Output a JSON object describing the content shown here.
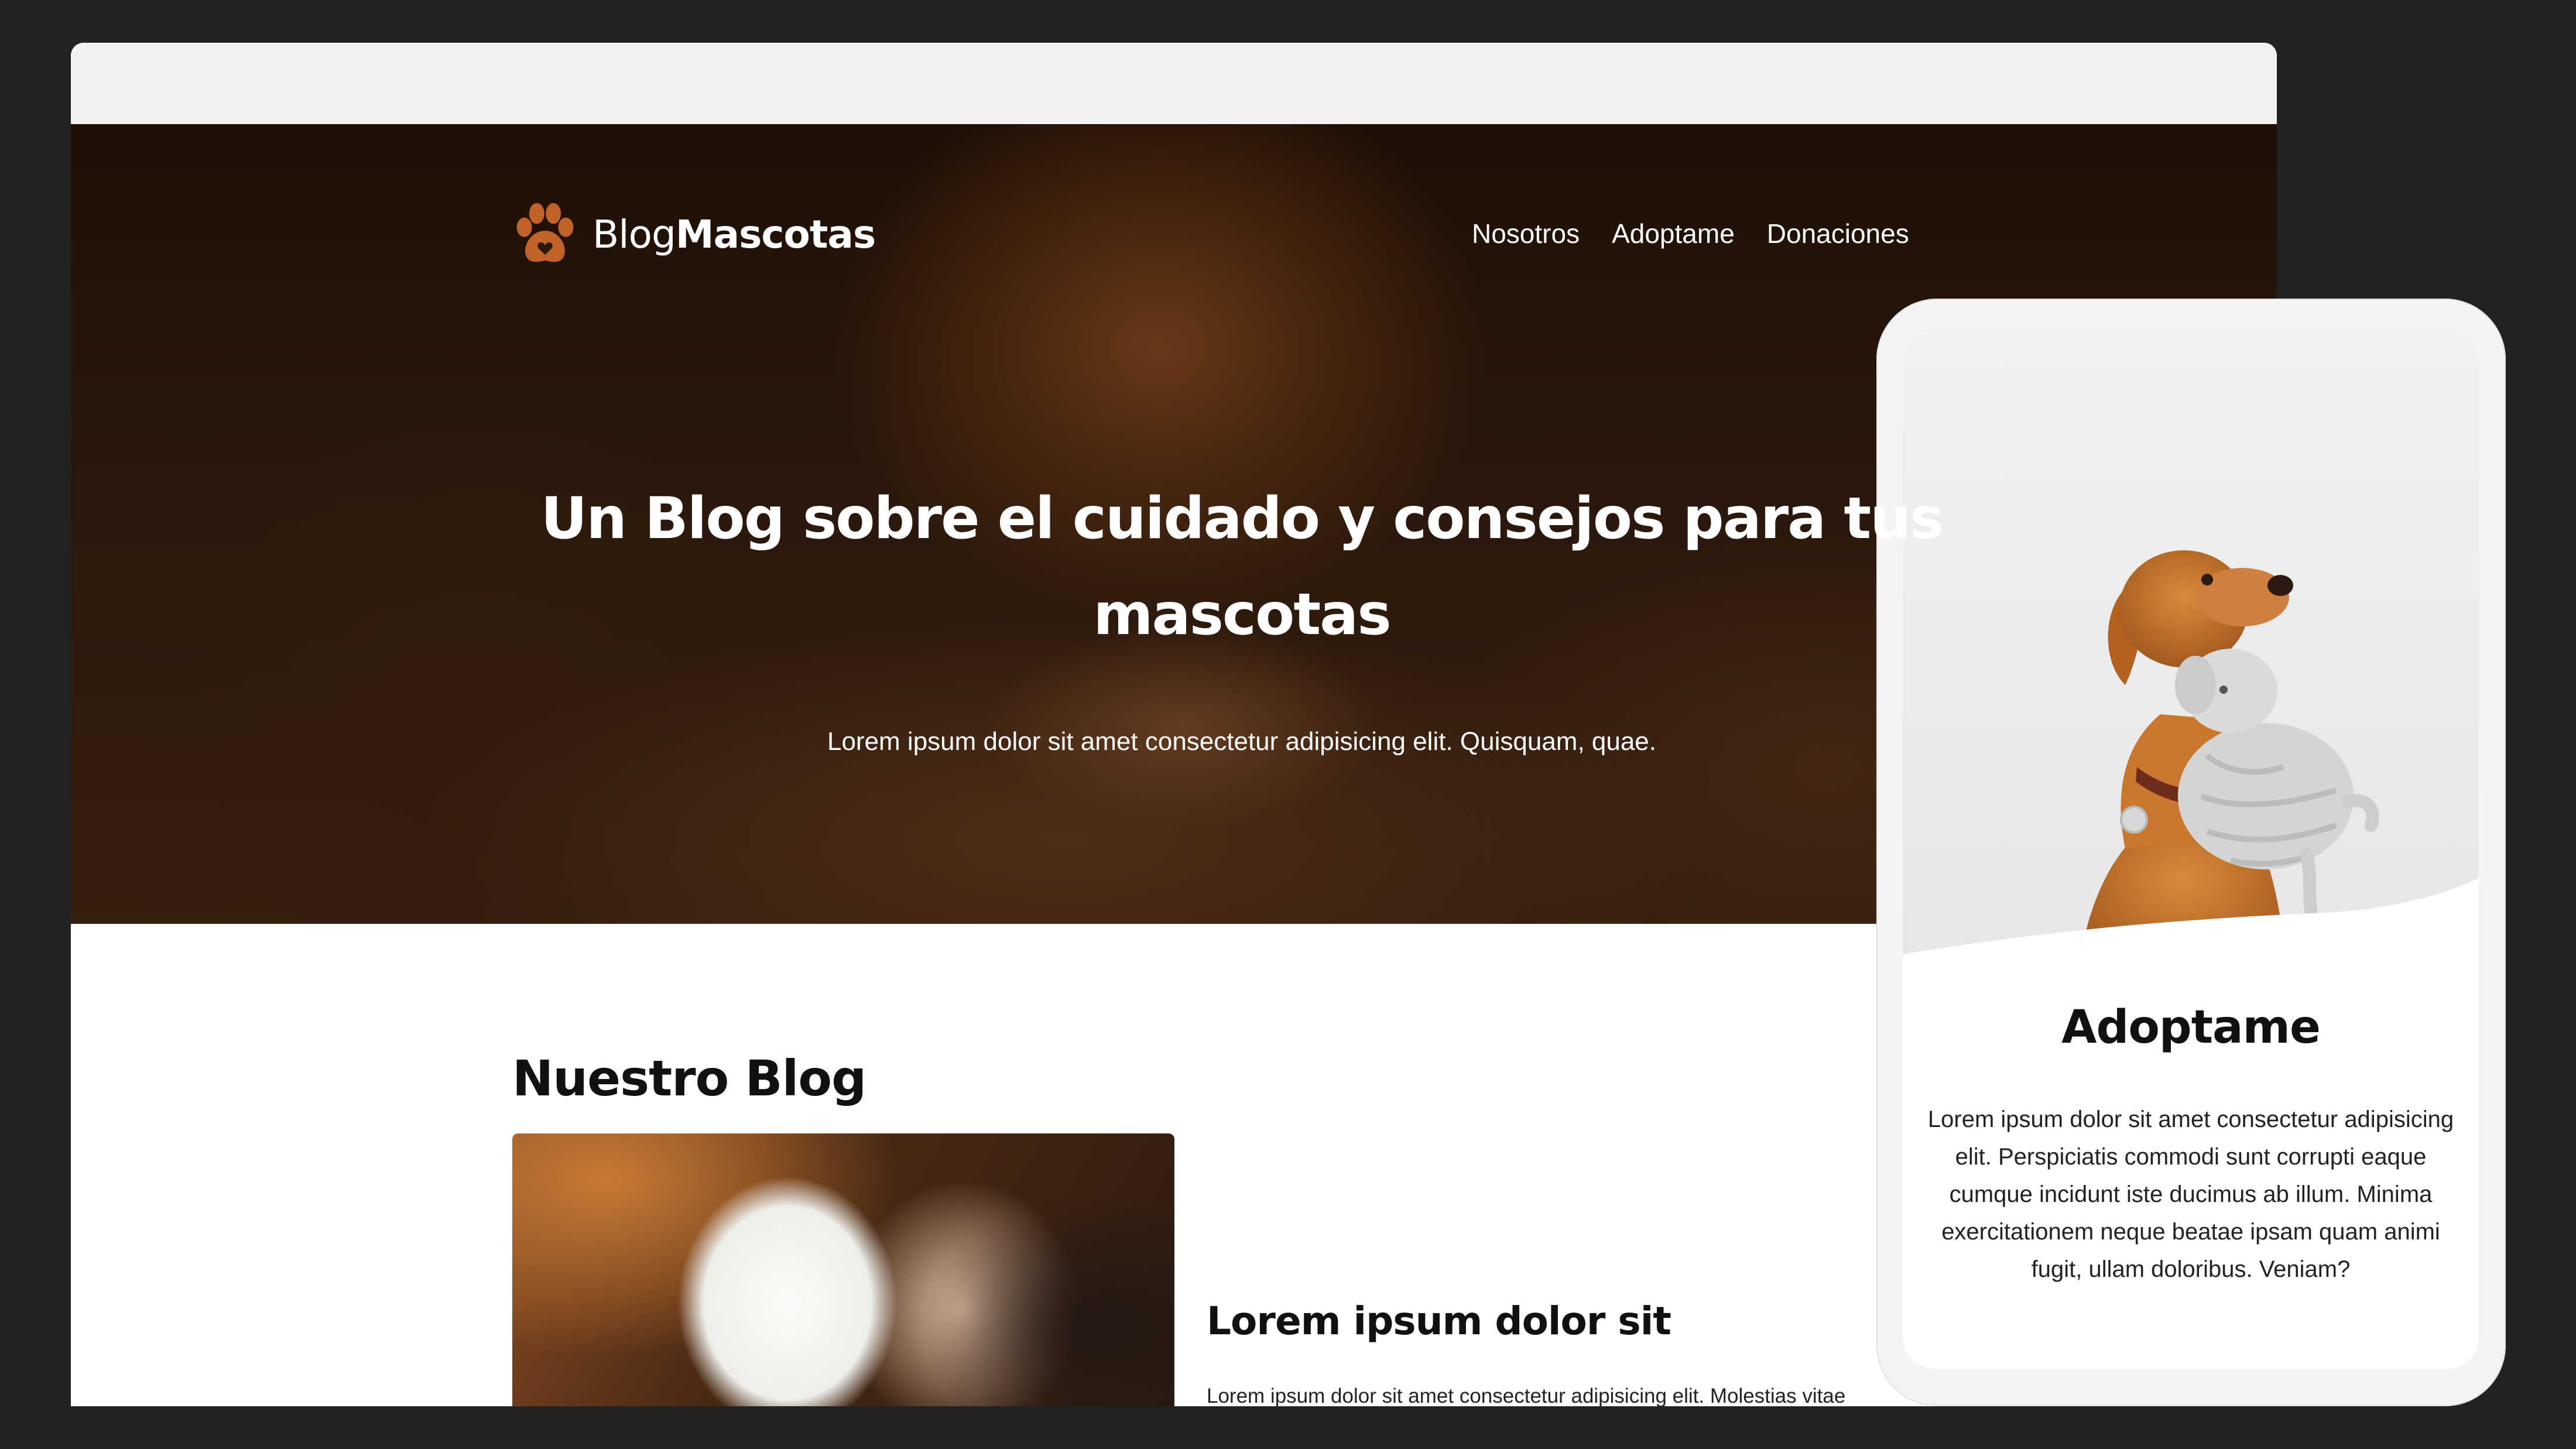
{
  "site": {
    "logo_light": "Blog",
    "logo_bold": "Mascotas",
    "brand_color": "#c0622a"
  },
  "nav": {
    "items": [
      "Nosotros",
      "Adoptame",
      "Donaciones"
    ]
  },
  "hero": {
    "title": "Un Blog sobre el cuidado y consejos para tus mascotas",
    "subtitle": "Lorem ipsum dolor sit amet consectetur adipisicing elit. Quisquam, quae."
  },
  "blog": {
    "section_title": "Nuestro Blog",
    "post": {
      "title": "Lorem ipsum dolor sit",
      "excerpt": "Lorem ipsum dolor sit amet consectetur adipisicing elit. Molestias vitae quos veritatis modi, molestiae facilis officiis."
    }
  },
  "mobile": {
    "title": "Adoptame",
    "text": "Lorem ipsum dolor sit amet consectetur adipisicing elit. Perspiciatis commodi sunt corrupti eaque cumque incidunt iste ducimus ab illum. Minima exercitationem neque beatae ipsam quam animi fugit, ullam doloribus. Veniam?"
  },
  "icons": {
    "logo": "paw-icon"
  }
}
